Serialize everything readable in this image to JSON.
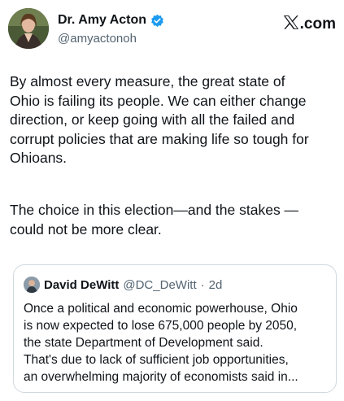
{
  "author": {
    "display_name": "Dr. Amy Acton",
    "handle": "@amyactonoh",
    "verified_color": "#1d9bf0"
  },
  "brand": {
    "icon": "x-logo-icon",
    "text": ".com"
  },
  "tweet": {
    "paragraph_1": "By almost every measure, the great state of\nOhio is failing its people. We can either change\ndirection, or keep going with all the failed and\ncorrupt policies that are making life so tough for\nOhioans.",
    "paragraph_2": "The choice in this election—and the stakes —\ncould not be more clear."
  },
  "quoted_tweet": {
    "display_name": "David DeWitt",
    "handle": "@DC_DeWitt",
    "separator": "·",
    "time": "2d",
    "text": "Once a political and economic powerhouse, Ohio\nis now expected to lose 675,000 people by 2050,\nthe state Department of Development said.\nThat's due to lack of sufficient job opportunities,\nan overwhelming majority of economists said in..."
  },
  "colors": {
    "text_primary": "#0f1419",
    "text_secondary": "#536471",
    "border": "#cfd9de"
  }
}
